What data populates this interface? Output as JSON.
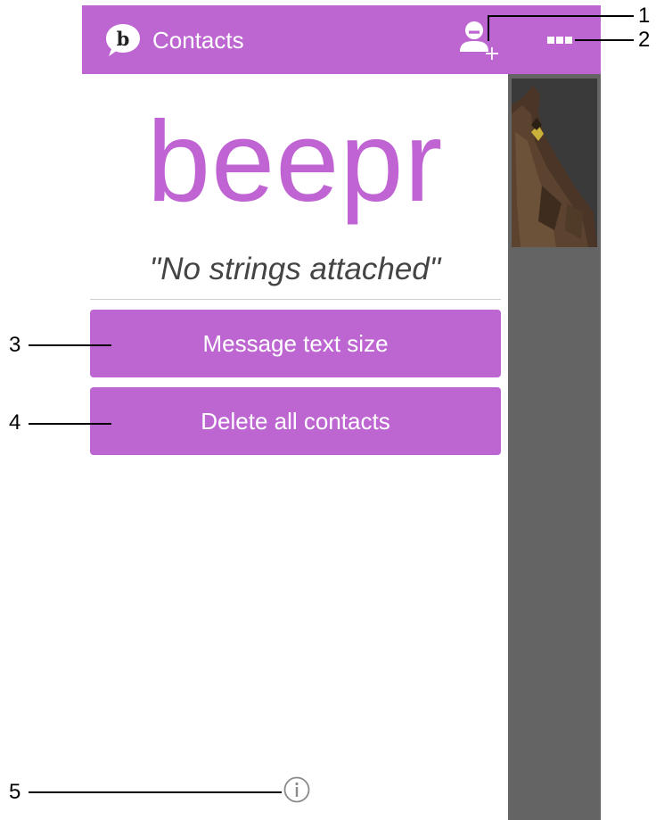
{
  "app_bar": {
    "logo_letter": "b",
    "title": "Contacts",
    "background_color": "#bd66d2",
    "add_contact_icon": "add-person-icon",
    "overflow_icon": "overflow-menu-icon"
  },
  "drawer": {
    "brand": "beepr",
    "tagline": "\"No strings attached\"",
    "brand_color": "#c064d4",
    "buttons": [
      {
        "label": "Message text size"
      },
      {
        "label": "Delete all contacts"
      }
    ],
    "info_icon": "info-icon"
  },
  "callouts": [
    "1",
    "2",
    "3",
    "4",
    "5"
  ]
}
